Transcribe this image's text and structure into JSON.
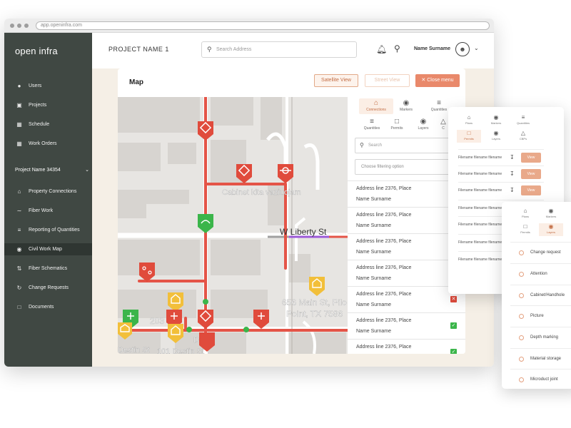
{
  "browser": {
    "url": "app.openinfra.com"
  },
  "sidebar": {
    "logo": "open infra",
    "top_items": [
      {
        "label": "Users",
        "icon": "user-icon"
      },
      {
        "label": "Projects",
        "icon": "clipboard-icon"
      },
      {
        "label": "Schedule",
        "icon": "calendar-icon"
      },
      {
        "label": "Work Orders",
        "icon": "calendar-icon"
      }
    ],
    "project_select": "Project Name 34354",
    "project_items": [
      {
        "label": "Property Connections",
        "icon": "home-icon"
      },
      {
        "label": "Fiber Work",
        "icon": "fiber-icon"
      },
      {
        "label": "Reporting of Quantities",
        "icon": "list-icon"
      },
      {
        "label": "Civil Work Map",
        "icon": "map-pin-icon",
        "active": true
      },
      {
        "label": "Fiber Schematics",
        "icon": "schematic-icon"
      },
      {
        "label": "Change Requests",
        "icon": "refresh-icon"
      },
      {
        "label": "Documents",
        "icon": "document-icon"
      }
    ]
  },
  "header": {
    "project_title": "PROJECT NAME 1",
    "search_placeholder": "Search Address",
    "username": "Name Surname"
  },
  "map_card": {
    "title": "Map",
    "buttons": {
      "satellite": "Satellite View",
      "street": "Street View",
      "close": "Close menu"
    },
    "map_labels": {
      "street": "W Liberty St",
      "cabinet": "Cabinet kita vaziuojam",
      "address1": "656 Main St, Pilo",
      "address2": "Point, TX 7586",
      "addr_partial": "203",
      "destin": "Destin St",
      "destin2": "101 Destin St",
      "d6": "D604"
    }
  },
  "panel": {
    "tabs_row1": [
      "Connections",
      "Markers",
      "Quantities"
    ],
    "tabs_row2": [
      "Quantities",
      "Permits",
      "Layers",
      "C"
    ],
    "search_placeholder": "Search",
    "filter_placeholder": "Choose filtering option",
    "addresses": [
      {
        "line1": "Address line 2376, Place",
        "line2": "Name Surname",
        "status": ""
      },
      {
        "line1": "Address line 2376, Place",
        "line2": "Name Surname",
        "status": ""
      },
      {
        "line1": "Address line 2376, Place",
        "line2": "Name Surname",
        "status": ""
      },
      {
        "line1": "Address line 2376, Place",
        "line2": "Name Surname",
        "status": ""
      },
      {
        "line1": "Address line 2376, Place",
        "line2": "Name Surname",
        "status": "rejected"
      },
      {
        "line1": "Address line 2376, Place",
        "line2": "Name Surname",
        "status": "approved"
      },
      {
        "line1": "Address line 2376, Place",
        "line2": "",
        "status": "approved"
      }
    ]
  },
  "float1": {
    "tabs_row1": [
      "Plans",
      "Markers",
      "Quantities"
    ],
    "tabs_row2": [
      "Permits",
      "Layers",
      "CBPs"
    ],
    "files": [
      {
        "name": "Filename filename filename",
        "view": "View"
      },
      {
        "name": "Filename filename filename",
        "view": "View"
      },
      {
        "name": "Filename filename filename",
        "view": "View"
      },
      {
        "name": "Filename filename filename",
        "view": ""
      },
      {
        "name": "Filename filename filename",
        "view": ""
      },
      {
        "name": "Filename filename filename",
        "view": ""
      },
      {
        "name": "Filename filename filename",
        "view": ""
      }
    ]
  },
  "float2": {
    "tabs_row1": [
      "Plans",
      "Markers"
    ],
    "tabs_row2": [
      "Permits",
      "Layers"
    ],
    "layers": [
      "Change request",
      "Attention",
      "Cabinet/Handhole",
      "Picture",
      "Depth marking",
      "Material storage",
      "Microduct joint"
    ]
  },
  "colors": {
    "accent": "#e9896b",
    "sidebar": "#404843",
    "route": "#e45447",
    "pin_red": "#e04b3c",
    "pin_green": "#3bb54a",
    "pin_yellow": "#f2bf3a"
  }
}
